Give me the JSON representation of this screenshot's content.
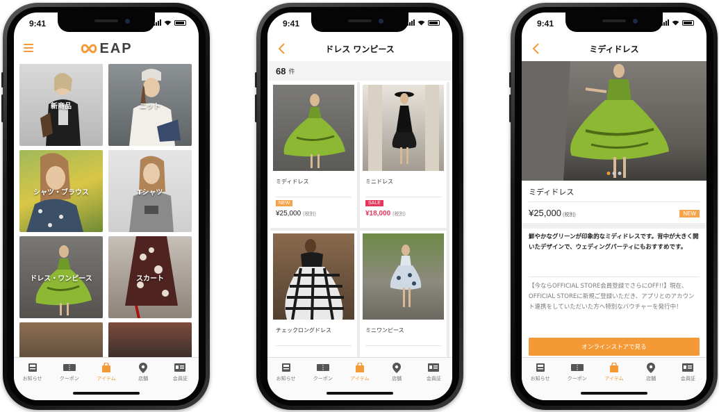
{
  "status": {
    "time": "9:41"
  },
  "tabs": [
    {
      "label": "お知らせ",
      "icon": "news-icon"
    },
    {
      "label": "クーポン",
      "icon": "coupon-icon"
    },
    {
      "label": "アイテム",
      "icon": "bag-icon"
    },
    {
      "label": "店舗",
      "icon": "location-pin-icon"
    },
    {
      "label": "会員証",
      "icon": "member-card-icon"
    }
  ],
  "active_tab": "アイテム",
  "accent_color": "#f39a36",
  "screen1": {
    "logo_text": "EAP",
    "categories": [
      {
        "label": "新商品"
      },
      {
        "label": "ニット"
      },
      {
        "label": "シャツ・ブラウス"
      },
      {
        "label": "Tシャツ"
      },
      {
        "label": "ドレス・ワンピース"
      },
      {
        "label": "スカート"
      }
    ]
  },
  "screen2": {
    "title": "ドレス ワンピース",
    "count": "68",
    "count_unit": "件",
    "products": [
      {
        "name": "ミディドレス",
        "badge": "NEW",
        "price": "¥25,000",
        "tax": "(税別)"
      },
      {
        "name": "ミニドレス",
        "badge": "SALE",
        "price": "¥18,000",
        "tax": "(税別)"
      },
      {
        "name": "チェックロングドレス",
        "badge": "",
        "price": "",
        "tax": ""
      },
      {
        "name": "ミニワンピース",
        "badge": "",
        "price": "",
        "tax": ""
      }
    ]
  },
  "screen3": {
    "title": "ミディドレス",
    "product_name": "ミディドレス",
    "price": "¥25,000",
    "tax": "(税別)",
    "badge": "NEW",
    "description": "鮮やかなグリーンが印象的なミディドレスです。背中が大きく開いたデザインで、ウェディングパーティにもおすすめです。",
    "promo": "【今ならOFFICIAL STORE会員登録でさらにOFF!!】現在、OFFICIAL STOREに新規ご登録いただき、アプリとのアカウント連携をしていただいた方へ特別なバウチャーを発行中！",
    "cta": "オンラインストアで見る"
  }
}
